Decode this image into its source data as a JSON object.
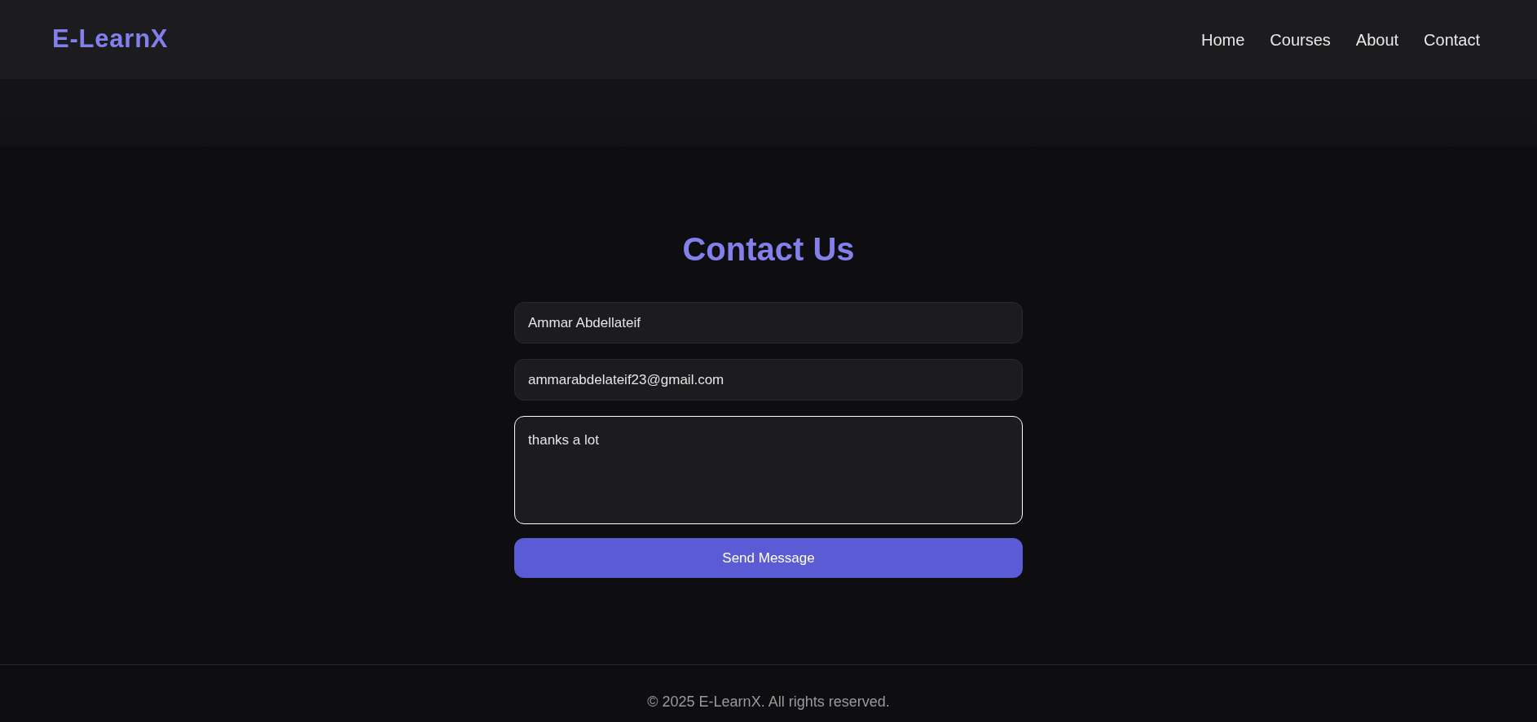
{
  "header": {
    "logo": "E-LearnX",
    "nav": [
      "Home",
      "Courses",
      "About",
      "Contact"
    ]
  },
  "contact": {
    "title": "Contact Us",
    "fields": [
      {
        "kind": "input",
        "value": "Ammar Abdellateif",
        "focused": false
      },
      {
        "kind": "input",
        "value": "ammarabdelateif23@gmail.com",
        "focused": false
      },
      {
        "kind": "textarea",
        "value": "thanks a lot",
        "focused": true
      }
    ],
    "button": "Send Message"
  },
  "footer": {
    "text": "© 2025 E-LearnX. All rights reserved."
  }
}
